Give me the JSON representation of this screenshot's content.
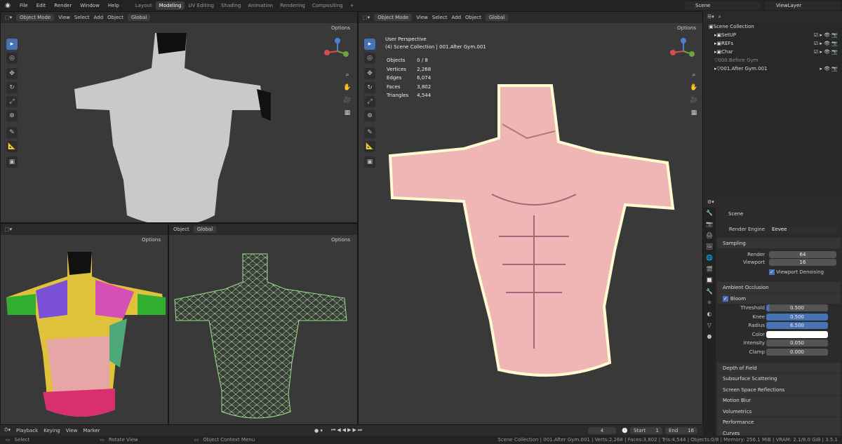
{
  "topbar": {
    "menus": [
      "File",
      "Edit",
      "Render",
      "Window",
      "Help"
    ],
    "workspaces": [
      "Layout",
      "Modeling",
      "UV Editing",
      "Shading",
      "Animation",
      "Rendering",
      "Compositing",
      "+"
    ],
    "active_ws": "Modeling",
    "scene": "Scene",
    "view_layer": "ViewLayer"
  },
  "vp_header": {
    "mode": "Object Mode",
    "view": "View",
    "select": "Select",
    "add": "Add",
    "object": "Object",
    "transform": "Global",
    "options": "Options"
  },
  "vp_small": {
    "object": "Object",
    "transform": "Global",
    "options": "Options"
  },
  "main_vp": {
    "perspective": "User Perspective",
    "collection": "(4) Scene Collection | 001.After Gym.001"
  },
  "stats": [
    [
      "Objects",
      "0 / 8"
    ],
    [
      "Vertices",
      "2,268"
    ],
    [
      "Edges",
      "6,074"
    ],
    [
      "Faces",
      "3,802"
    ],
    [
      "Triangles",
      "4,544"
    ]
  ],
  "outliner": {
    "root": "Scene Collection",
    "items": [
      "SetUP",
      "REFs",
      "Char",
      "000.Before Gym",
      "001.After Gym.001"
    ]
  },
  "properties": {
    "scene": "Scene",
    "render_engine_label": "Render Engine",
    "render_engine": "Eevee",
    "sampling": "Sampling",
    "render_label": "Render",
    "render_val": "64",
    "viewport_label": "Viewport",
    "viewport_val": "16",
    "denoise": "Viewport Denoising",
    "ao": "Ambient Occlusion",
    "bloom": "Bloom",
    "bloom_fields": [
      [
        "Threshold",
        "0.500",
        0.05
      ],
      [
        "Knee",
        "0.500",
        1
      ],
      [
        "Radius",
        "6.500",
        1
      ],
      [
        "Color",
        "",
        0
      ],
      [
        "Intensity",
        "0.050",
        0
      ],
      [
        "Clamp",
        "0.000",
        0
      ]
    ],
    "sections": [
      "Depth of Field",
      "Subsurface Scattering",
      "Screen Space Reflections",
      "Motion Blur",
      "Volumetrics",
      "Performance",
      "Curves"
    ]
  },
  "timeline": {
    "playback": "Playback",
    "keying": "Keying",
    "view": "View",
    "marker": "Marker",
    "frame": "4",
    "start_label": "Start",
    "start": "1",
    "end_label": "End",
    "end": "16"
  },
  "status": {
    "select": "Select",
    "rotate": "Rotate View",
    "context": "Object Context Menu",
    "info": "Scene Collection | 001.After Gym.001 | Verts:2,268 | Faces:3,802 | Tris:4,544 | Objects:0/8 | Memory: 256.1 MiB | VRAM: 2.1/8.0 GiB | 3.5.1"
  },
  "colors": {
    "accent": "#4772b3",
    "bg": "#393939",
    "header": "#2a2a2a"
  }
}
